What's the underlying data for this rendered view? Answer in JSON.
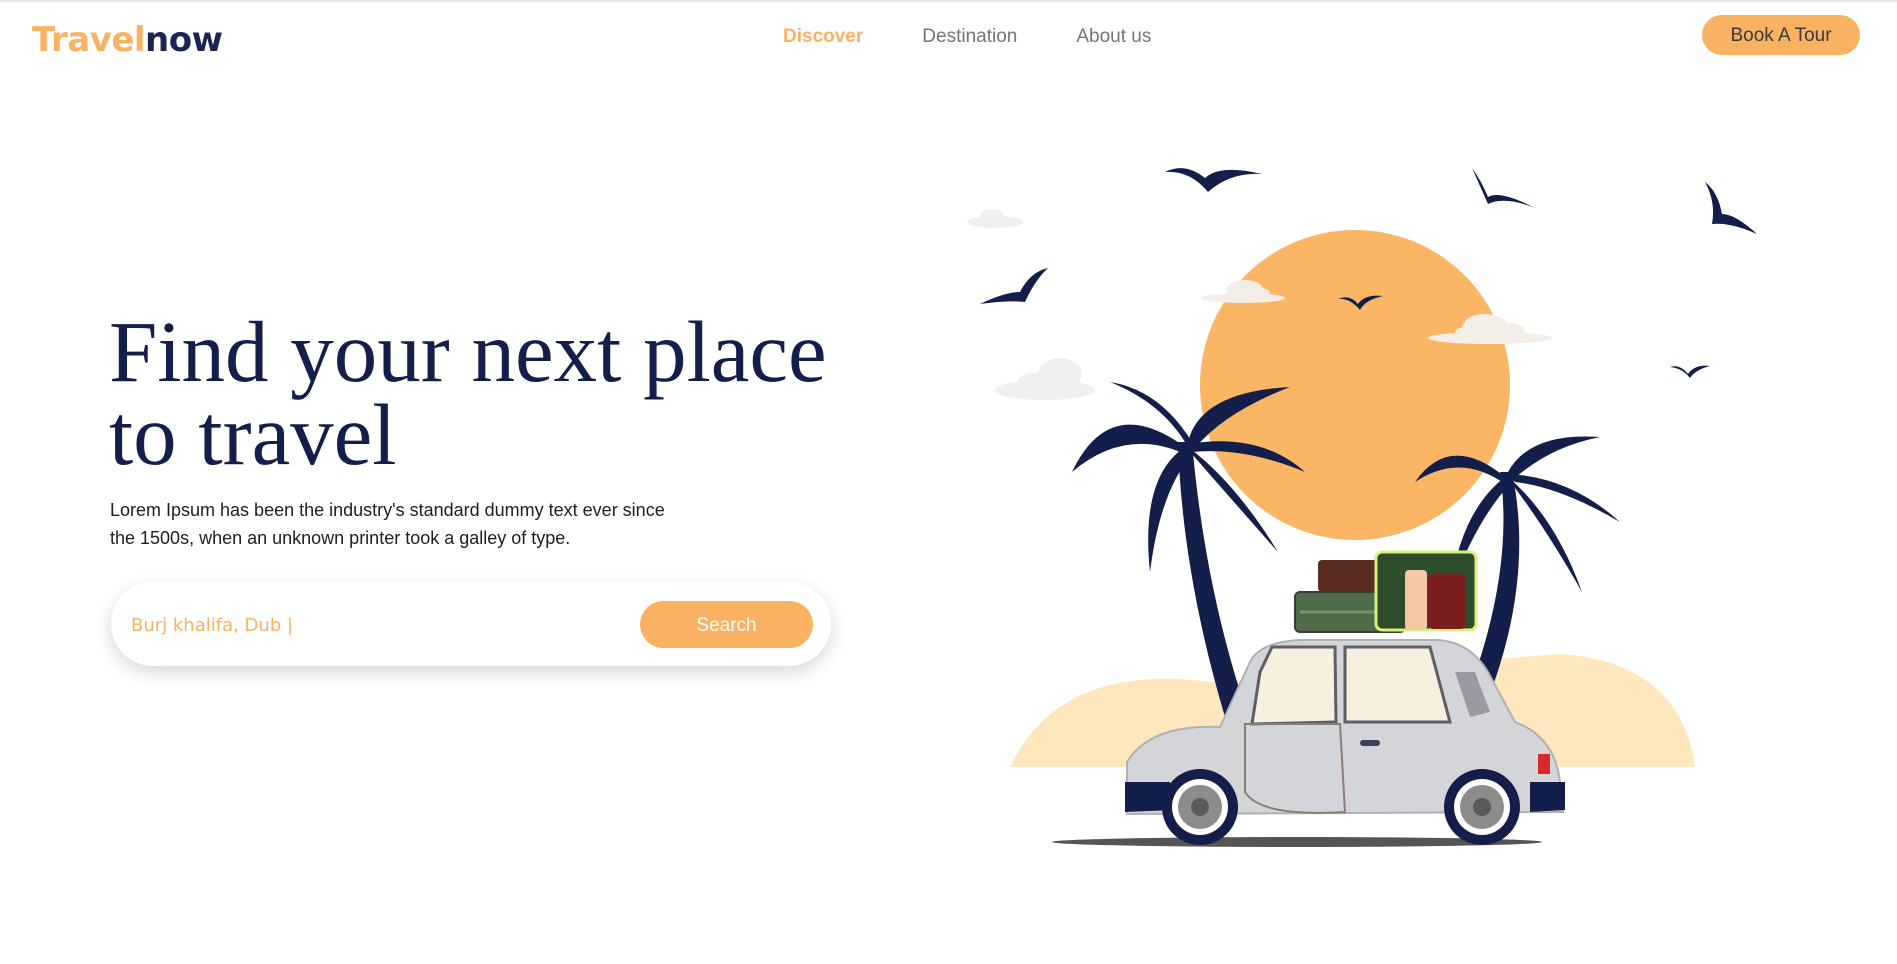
{
  "brand": {
    "part1": "Travel",
    "part2": "now"
  },
  "nav": {
    "items": [
      {
        "label": "Discover",
        "active": true
      },
      {
        "label": "Destination",
        "active": false
      },
      {
        "label": "About us",
        "active": false
      }
    ]
  },
  "header": {
    "cta_label": "Book A Tour"
  },
  "hero": {
    "title_line1": "Find your next place",
    "title_line2": "to travel",
    "description_line1": "Lorem Ipsum has been the industry's standard dummy text ever since",
    "description_line2": "the 1500s, when an unknown printer took a galley of type."
  },
  "search": {
    "value": "Burj khalifa, Dub |",
    "button_label": "Search"
  },
  "colors": {
    "accent": "#f9b262",
    "navy": "#131e4a",
    "sand": "#fde8bd",
    "car": "#d4d5d9"
  },
  "illustration": {
    "icons": [
      "sun-icon",
      "palm-tree-icon",
      "bird-icon",
      "cloud-icon",
      "car-icon",
      "suitcase-icon"
    ]
  }
}
